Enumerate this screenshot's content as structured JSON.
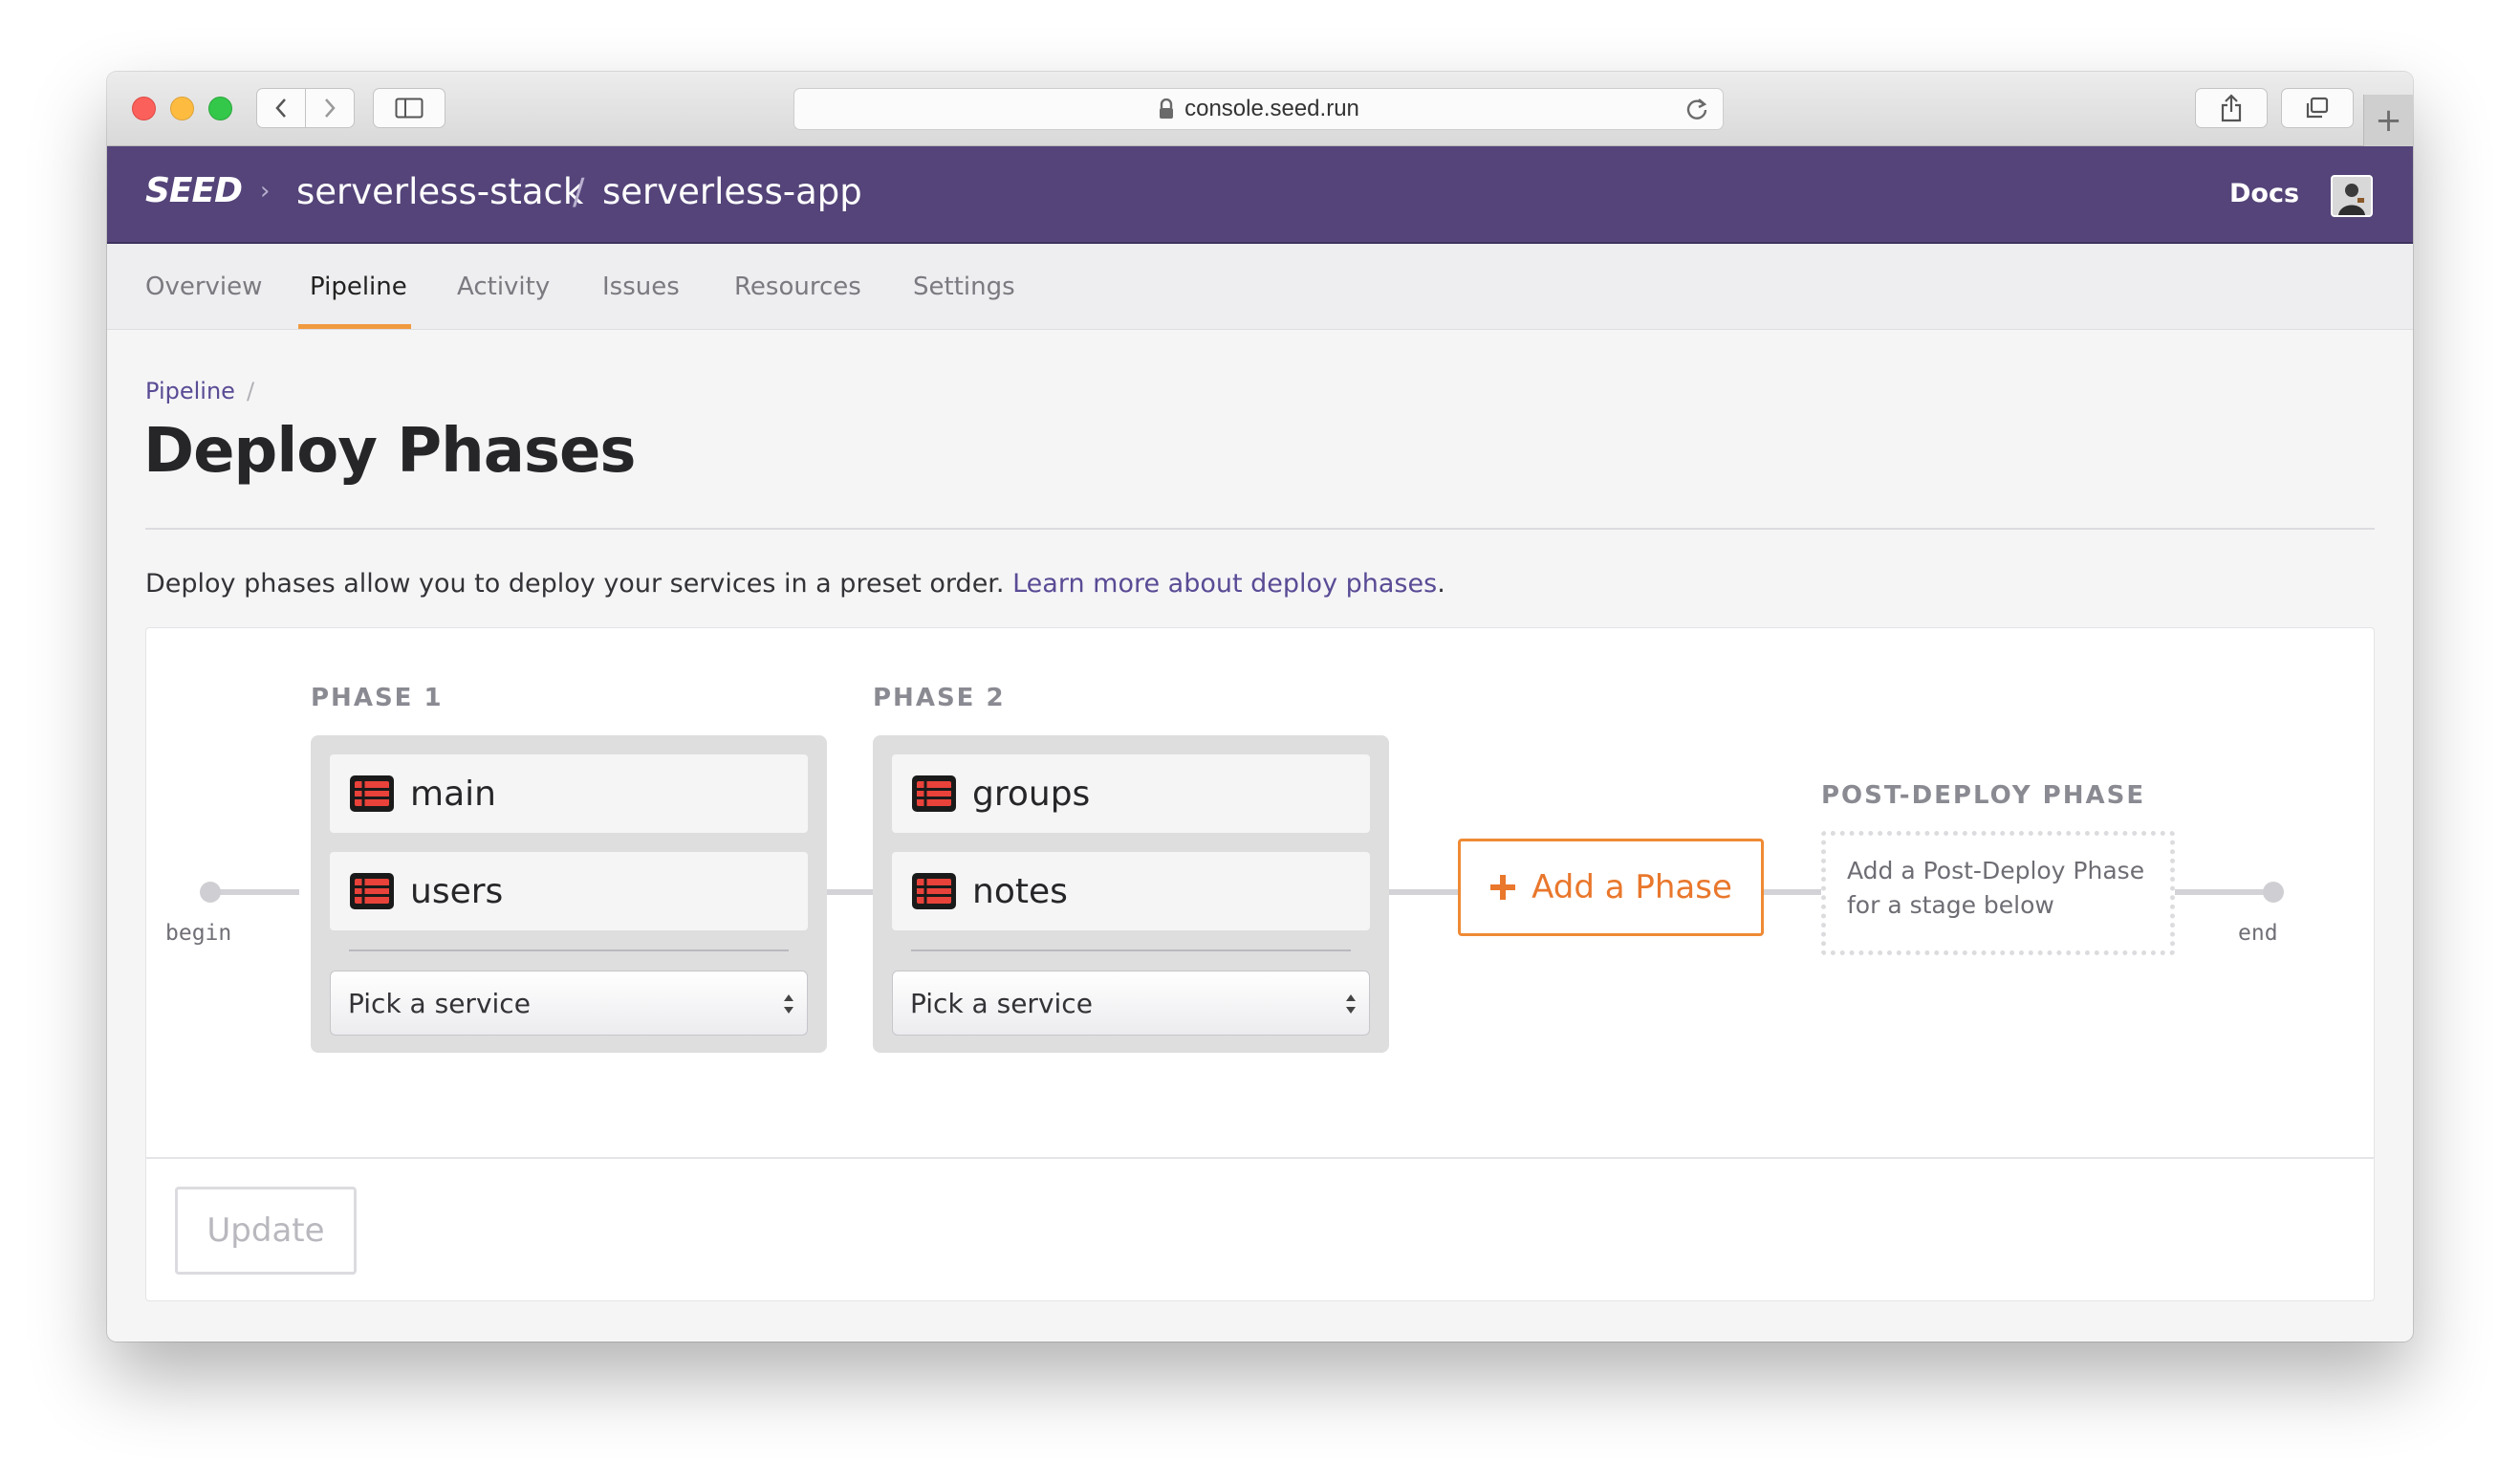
{
  "browser": {
    "url": "console.seed.run",
    "icons": [
      "back-icon",
      "forward-icon",
      "sidebar-icon",
      "lock-icon",
      "reload-icon",
      "share-icon",
      "tabs-icon",
      "new-tab-icon"
    ],
    "new_tab": "+"
  },
  "header": {
    "logo": "SEED",
    "breadcrumb_chevron": "›",
    "org": "serverless-stack",
    "separator": "/",
    "app": "serverless-app",
    "docs": "Docs"
  },
  "tabs": [
    {
      "label": "Overview",
      "active": false
    },
    {
      "label": "Pipeline",
      "active": true
    },
    {
      "label": "Activity",
      "active": false
    },
    {
      "label": "Issues",
      "active": false
    },
    {
      "label": "Resources",
      "active": false
    },
    {
      "label": "Settings",
      "active": false
    }
  ],
  "breadcrumb": {
    "link": "Pipeline",
    "separator": "/"
  },
  "page_title": "Deploy Phases",
  "intro": {
    "text": "Deploy phases allow you to deploy your services in a preset order. ",
    "link": "Learn more about deploy phases",
    "tail": "."
  },
  "pipeline": {
    "begin_label": "begin",
    "end_label": "end",
    "phases": [
      {
        "title": "PHASE 1",
        "services": [
          "main",
          "users"
        ],
        "picker": "Pick a service"
      },
      {
        "title": "PHASE 2",
        "services": [
          "groups",
          "notes"
        ],
        "picker": "Pick a service"
      }
    ],
    "add_phase": "Add a Phase",
    "post_deploy": {
      "title": "POST-DEPLOY PHASE",
      "line1": "Add a Post-Deploy Phase",
      "line2": "for a stage below"
    }
  },
  "update_button": "Update",
  "colors": {
    "header": "#544479",
    "accent": "#ef8a34",
    "link": "#5a4b95",
    "service_icon": "#e9423a"
  }
}
